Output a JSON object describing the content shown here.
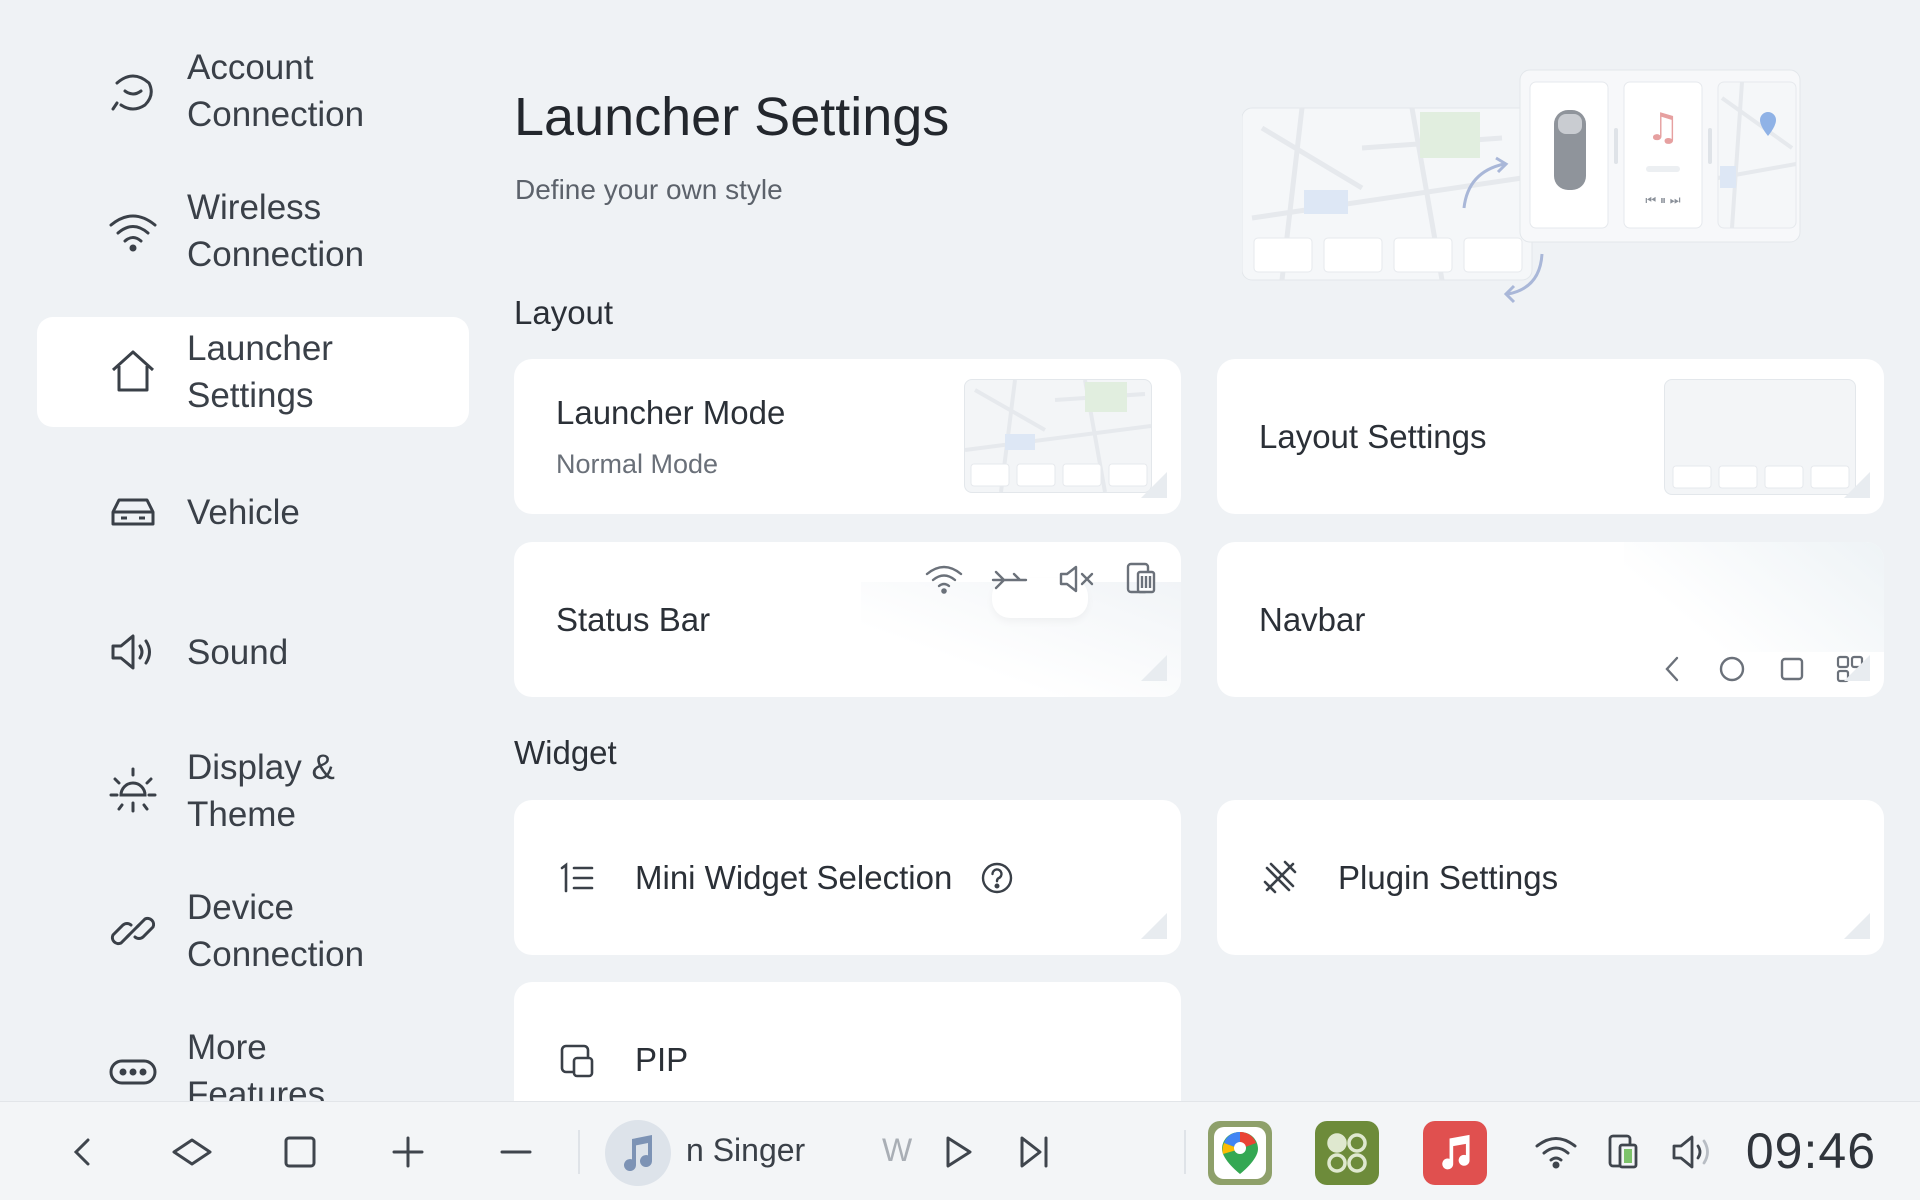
{
  "sidebar": {
    "items": [
      {
        "label": "Account\nConnection",
        "icon": "account-link-icon",
        "active": false
      },
      {
        "label": "Wireless\nConnection",
        "icon": "wifi-icon",
        "active": false
      },
      {
        "label": "Launcher\nSettings",
        "icon": "home-icon",
        "active": true
      },
      {
        "label": "Vehicle",
        "icon": "car-icon",
        "active": false
      },
      {
        "label": "Sound",
        "icon": "speaker-icon",
        "active": false
      },
      {
        "label": "Display &\nTheme",
        "icon": "sun-icon",
        "active": false
      },
      {
        "label": "Device\nConnection",
        "icon": "link-icon",
        "active": false
      },
      {
        "label": "More\nFeatures",
        "icon": "more-icon",
        "active": false
      }
    ]
  },
  "main": {
    "title": "Launcher Settings",
    "subtitle": "Define your own style",
    "layout_section": "Layout",
    "widget_section": "Widget",
    "cards": {
      "launcher_mode": {
        "title": "Launcher Mode",
        "value": "Normal Mode"
      },
      "layout_settings": {
        "title": "Layout Settings"
      },
      "status_bar": {
        "title": "Status Bar"
      },
      "navbar": {
        "title": "Navbar"
      },
      "mini_widget": {
        "title": "Mini Widget Selection"
      },
      "plugin_settings": {
        "title": "Plugin Settings"
      },
      "pip": {
        "title": "PIP"
      }
    }
  },
  "dock": {
    "media_text_1": "n Singer",
    "media_text_2": "W",
    "clock": "09:46"
  },
  "colors": {
    "background": "#eff2f5",
    "card": "#ffffff",
    "maps_green": "#6d8b3a",
    "music_red": "#e0504f"
  }
}
